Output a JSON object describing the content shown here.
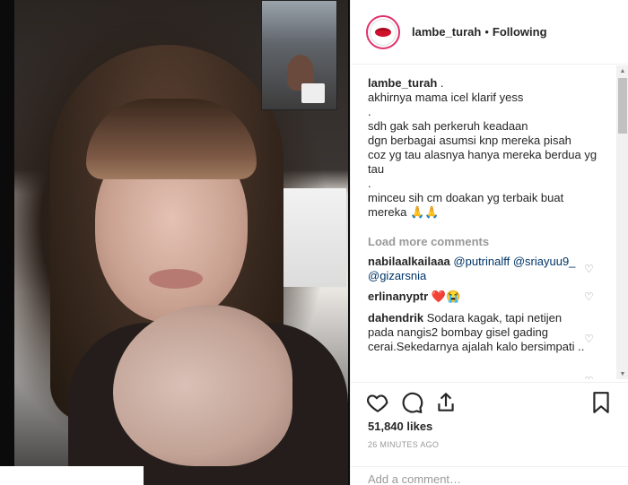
{
  "header": {
    "username": "lambe_turah",
    "separator": "•",
    "follow_status": "Following"
  },
  "caption": {
    "username": "lambe_turah",
    "lines": [
      " .",
      "akhirnya mama icel klarif yess",
      ".",
      "sdh gak sah perkeruh keadaan",
      "dgn berbagai asumsi knp mereka pisah",
      "coz yg tau alasnya hanya mereka berdua yg",
      "tau",
      ".",
      "minceu sih cm doakan yg terbaik buat",
      "mereka 🙏🙏"
    ]
  },
  "load_more": "Load more comments",
  "comments": [
    {
      "username": "nabilaalkailaaa",
      "text": "@putrinalff @sriayuu9_ @gizarsnia",
      "mention": true
    },
    {
      "username": "erlinanyptr",
      "text": "❤️😭",
      "mention": false
    },
    {
      "username": "dahendrik",
      "text": "Sodara kagak, tapi netijen pada nangis2 bombay gisel gading cerai.Sekedarnya ajalah kalo bersimpati ..",
      "mention": false
    }
  ],
  "actions": {
    "likes": "51,840 likes",
    "time": "26 MINUTES AGO"
  },
  "add_comment_placeholder": "Add a comment…",
  "icons": {
    "like": "heart-icon",
    "comment": "comment-icon",
    "share": "share-icon",
    "save": "bookmark-icon"
  },
  "colors": {
    "accent": "#e1306c",
    "text": "#262626",
    "muted": "#999999",
    "mention": "#003569"
  }
}
